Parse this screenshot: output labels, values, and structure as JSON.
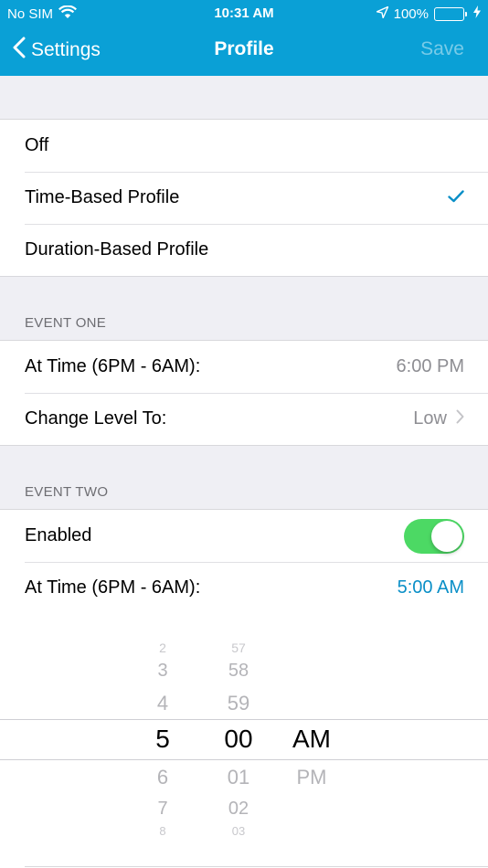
{
  "status": {
    "carrier": "No SIM",
    "time": "10:31 AM",
    "battery": "100%"
  },
  "nav": {
    "back_label": "Settings",
    "title": "Profile",
    "save_label": "Save"
  },
  "profile_options": [
    {
      "label": "Off",
      "checked": false
    },
    {
      "label": "Time-Based Profile",
      "checked": true
    },
    {
      "label": "Duration-Based Profile",
      "checked": false
    }
  ],
  "event_one": {
    "header": "EVENT ONE",
    "at_time_label": "At Time (6PM - 6AM):",
    "at_time_value": "6:00 PM",
    "change_level_label": "Change Level To:",
    "change_level_value": "Low"
  },
  "event_two": {
    "header": "EVENT TWO",
    "enabled_label": "Enabled",
    "enabled": true,
    "at_time_label": "At Time (6PM - 6AM):",
    "at_time_value": "5:00 AM"
  },
  "picker": {
    "hours": [
      "2",
      "3",
      "4",
      "5",
      "6",
      "7",
      "8"
    ],
    "minutes": [
      "57",
      "58",
      "59",
      "00",
      "01",
      "02",
      "03"
    ],
    "periods": [
      "AM",
      "PM"
    ]
  },
  "colors": {
    "nav_bg": "#0aa0d6",
    "accent": "#0a8fc7",
    "toggle_on": "#4cd964"
  }
}
